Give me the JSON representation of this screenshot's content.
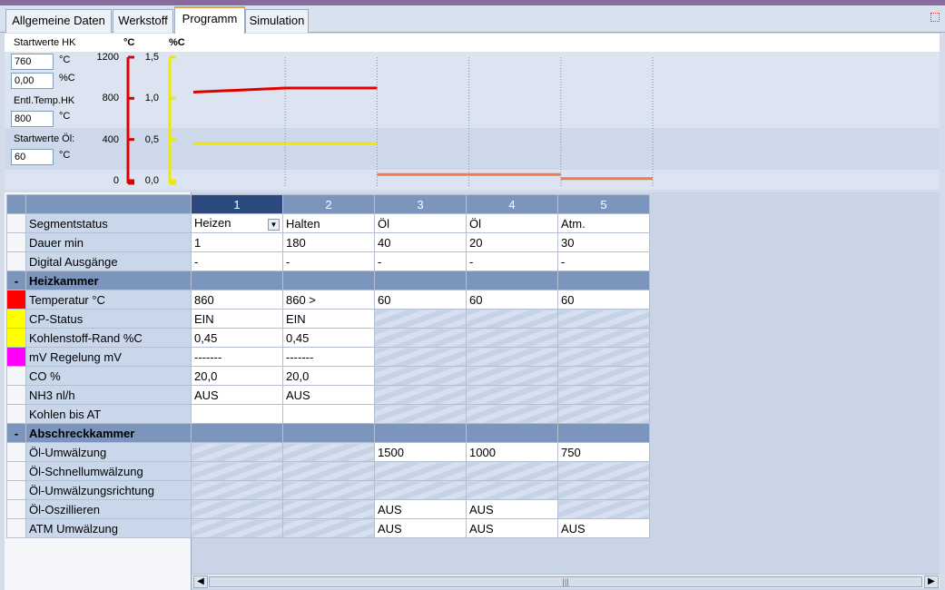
{
  "tabs": [
    "Allgemeine Daten",
    "Werkstoff",
    "Programm",
    "Simulation"
  ],
  "active_tab": "Programm",
  "start": {
    "hk_label": "Startwerte HK",
    "hk_temp": "760",
    "hk_temp_unit": "°C",
    "hk_c": "0,00",
    "hk_c_unit": "%C",
    "entl_label": "Entl.Temp.HK",
    "entl_temp": "800",
    "entl_unit": "°C",
    "oel_label": "Startwerte Öl:",
    "oel_temp": "60",
    "oel_unit": "°C"
  },
  "chart_data": {
    "type": "line",
    "temp_axis": {
      "unit": "°C",
      "ticks": [
        "1200",
        "800",
        "400",
        "0"
      ],
      "range": [
        0,
        1200
      ]
    },
    "c_axis": {
      "unit": "%C",
      "ticks": [
        "1,5",
        "1,0",
        "0,5",
        "0,0"
      ],
      "range": [
        0,
        1.5
      ]
    },
    "segments": [
      1,
      2,
      3,
      4,
      5
    ],
    "series": [
      {
        "name": "Temperatur",
        "color": "#e00000",
        "points": [
          [
            0,
            860
          ],
          [
            1,
            900
          ],
          [
            2,
            900
          ]
        ]
      },
      {
        "name": "Kohlenstoff",
        "color": "#f0e800",
        "points": [
          [
            0,
            0.45
          ],
          [
            2,
            0.45
          ]
        ]
      },
      {
        "name": "Öl",
        "color": "#f07a50",
        "points": [
          [
            2,
            60
          ],
          [
            4,
            60
          ]
        ]
      },
      {
        "name": "Atm",
        "color": "#f07a50",
        "points": [
          [
            4,
            20
          ],
          [
            5,
            20
          ]
        ]
      }
    ]
  },
  "grid": {
    "columns": [
      "1",
      "2",
      "3",
      "4",
      "5"
    ],
    "selected_column": "1",
    "rows": [
      {
        "label": "Segmentstatus",
        "cells": [
          "Heizen",
          "Halten",
          "Öl",
          "Öl",
          "Atm."
        ],
        "color": ""
      },
      {
        "label": "Dauer  min",
        "cells": [
          "1",
          "180",
          "40",
          "20",
          "30"
        ],
        "color": ""
      },
      {
        "label": "Digital Ausgänge",
        "cells": [
          "-",
          "-",
          "-",
          "-",
          "-"
        ],
        "color": ""
      }
    ],
    "section1": {
      "toggle": "-",
      "title": "Heizkammer"
    },
    "rows1": [
      {
        "label": "Temperatur  °C",
        "cells": [
          "860",
          "860 >",
          "60",
          "60",
          "60"
        ],
        "color": "#ff0000"
      },
      {
        "label": "CP-Status",
        "cells": [
          "EIN",
          "EIN",
          null,
          null,
          null
        ],
        "color": "#ffff00"
      },
      {
        "label": "Kohlenstoff-Rand  %C",
        "cells": [
          "0,45",
          "0,45",
          null,
          null,
          null
        ],
        "color": "#ffff00"
      },
      {
        "label": "mV Regelung  mV",
        "cells": [
          "-------",
          "-------",
          null,
          null,
          null
        ],
        "color": "#ff00ff"
      },
      {
        "label": "CO  %",
        "cells": [
          "20,0",
          "20,0",
          null,
          null,
          null
        ],
        "color": ""
      },
      {
        "label": "NH3  nl/h",
        "cells": [
          "AUS",
          "AUS",
          null,
          null,
          null
        ],
        "color": ""
      },
      {
        "label": "Kohlen bis  AT",
        "cells": [
          "",
          "",
          null,
          null,
          null
        ],
        "color": ""
      }
    ],
    "section2": {
      "toggle": "-",
      "title": "Abschreckkammer"
    },
    "rows2": [
      {
        "label": "Öl-Umwälzung",
        "cells": [
          null,
          null,
          "1500",
          "1000",
          "750"
        ],
        "color": ""
      },
      {
        "label": "Öl-Schnellumwälzung",
        "cells": [
          null,
          null,
          null,
          null,
          null
        ],
        "color": ""
      },
      {
        "label": "Öl-Umwälzungsrichtung",
        "cells": [
          null,
          null,
          null,
          null,
          null
        ],
        "color": ""
      },
      {
        "label": "Öl-Oszillieren",
        "cells": [
          null,
          null,
          "AUS",
          "AUS",
          null
        ],
        "color": ""
      },
      {
        "label": "ATM Umwälzung",
        "cells": [
          null,
          null,
          "AUS",
          "AUS",
          "AUS"
        ],
        "color": ""
      }
    ]
  }
}
